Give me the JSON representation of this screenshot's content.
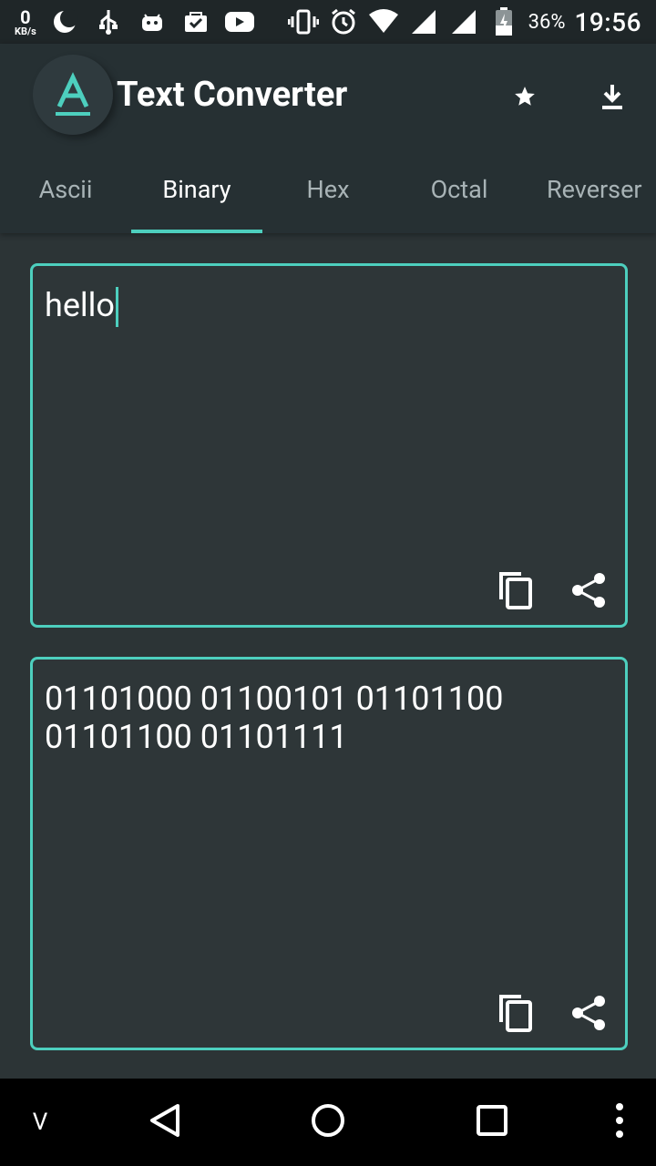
{
  "status_bar": {
    "data_rate_value": "0",
    "data_rate_unit": "KB/s",
    "battery": "36%",
    "time": "19:56"
  },
  "app": {
    "title": "Text Converter",
    "accent_color": "#4dcfbe"
  },
  "tabs": [
    {
      "label": "Ascii",
      "active": false
    },
    {
      "label": "Binary",
      "active": true
    },
    {
      "label": "Hex",
      "active": false
    },
    {
      "label": "Octal",
      "active": false
    },
    {
      "label": "Reverser",
      "active": false
    }
  ],
  "input_card": {
    "text": "hello"
  },
  "output_card": {
    "text": "01101000 01100101 01101100\n01101100 01101111"
  },
  "navbar": {
    "left_label": "V"
  },
  "icons": {
    "star": "star-icon",
    "download": "download-icon",
    "copy": "copy-icon",
    "share": "share-icon",
    "back": "back-triangle-icon",
    "home": "home-circle-icon",
    "recents": "recents-square-icon",
    "menu": "more-vert-icon"
  }
}
